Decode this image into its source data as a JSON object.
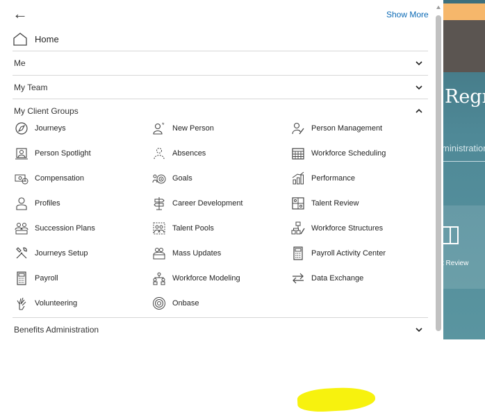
{
  "navigator": {
    "back_label": "←",
    "show_more": "Show More",
    "home_label": "Home",
    "sections": [
      {
        "label": "Me",
        "expanded": false
      },
      {
        "label": "My Team",
        "expanded": false
      },
      {
        "label": "My Client Groups",
        "expanded": true
      },
      {
        "label": "Benefits Administration",
        "expanded": false
      }
    ],
    "items": [
      {
        "label": "Journeys",
        "icon": "journeys-icon"
      },
      {
        "label": "New Person",
        "icon": "new-person-icon"
      },
      {
        "label": "Person Management",
        "icon": "person-management-icon"
      },
      {
        "label": "Person Spotlight",
        "icon": "person-spotlight-icon"
      },
      {
        "label": "Absences",
        "icon": "absences-icon"
      },
      {
        "label": "Workforce Scheduling",
        "icon": "calendar-icon"
      },
      {
        "label": "Compensation",
        "icon": "compensation-icon"
      },
      {
        "label": "Goals",
        "icon": "goals-icon"
      },
      {
        "label": "Performance",
        "icon": "performance-icon"
      },
      {
        "label": "Profiles",
        "icon": "profile-icon"
      },
      {
        "label": "Career Development",
        "icon": "signpost-icon"
      },
      {
        "label": "Talent Review",
        "icon": "talent-review-icon"
      },
      {
        "label": "Succession Plans",
        "icon": "succession-icon"
      },
      {
        "label": "Talent Pools",
        "icon": "talent-pools-icon"
      },
      {
        "label": "Workforce Structures",
        "icon": "structures-icon"
      },
      {
        "label": "Journeys Setup",
        "icon": "tools-icon"
      },
      {
        "label": "Mass Updates",
        "icon": "mass-updates-icon"
      },
      {
        "label": "Payroll Activity Center",
        "icon": "calculator-icon"
      },
      {
        "label": "Payroll",
        "icon": "payroll-calculator-icon"
      },
      {
        "label": "Workforce Modeling",
        "icon": "modeling-icon"
      },
      {
        "label": "Data Exchange",
        "icon": "exchange-arrows-icon",
        "highlighted": true
      },
      {
        "label": "Volunteering",
        "icon": "volunteering-icon"
      },
      {
        "label": "Onbase",
        "icon": "onbase-icon"
      }
    ]
  },
  "background_page": {
    "title_fragment": "Regn",
    "subtitle_fragment": "ministration",
    "tile_label": "t Review",
    "colors": {
      "teal": "#4f8997",
      "orange": "#f6b76b",
      "dark": "#5b5551"
    }
  },
  "colors": {
    "link": "#0a69b5",
    "highlight": "#f7f20e",
    "divider": "#d6d6d6"
  }
}
